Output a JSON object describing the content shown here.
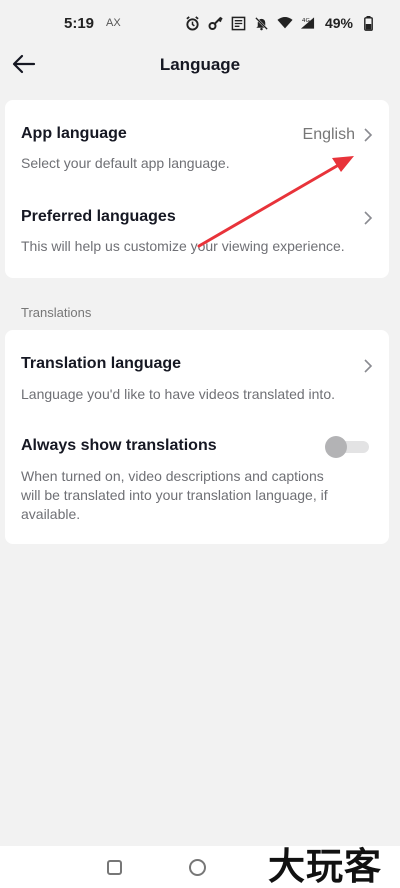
{
  "status_bar": {
    "time": "5:19",
    "carrier": "AX",
    "battery": "49%",
    "icons": [
      "alarm-icon",
      "key-icon",
      "vpn-icon",
      "mute-icon",
      "wifi-icon",
      "signal-icon",
      "battery-icon"
    ]
  },
  "header": {
    "title": "Language",
    "back_icon": "arrow-left-icon"
  },
  "settings": {
    "app_language": {
      "title": "App language",
      "value": "English",
      "description": "Select your default app language."
    },
    "preferred_languages": {
      "title": "Preferred languages",
      "description": "This will help us customize your viewing experience."
    }
  },
  "translations": {
    "section_label": "Translations",
    "translation_language": {
      "title": "Translation language",
      "description": "Language you'd like to have videos translated into."
    },
    "always_show": {
      "title": "Always show translations",
      "description_lines": [
        "When turned on, video descriptions and captions",
        "will be translated into your translation language, if",
        "available."
      ],
      "enabled": false
    }
  },
  "watermark": {
    "text": "大玩客"
  },
  "colors": {
    "background": "#f2f2f2",
    "card": "#ffffff",
    "arrow": "#e8333a",
    "muted_text": "#6f7075"
  }
}
